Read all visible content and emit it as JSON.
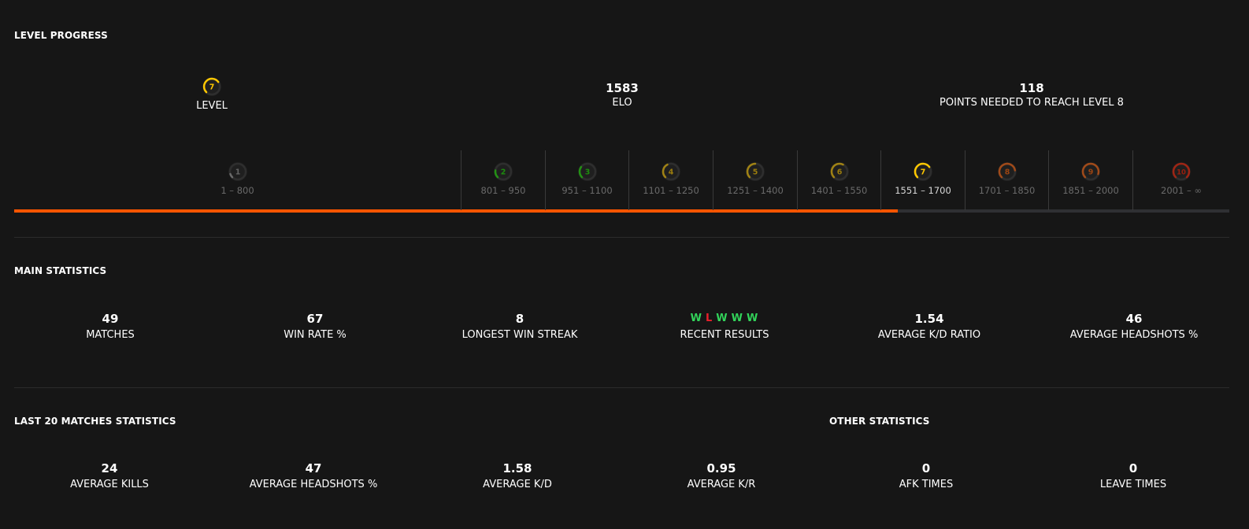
{
  "level_progress": {
    "title": "LEVEL PROGRESS",
    "level_label": "LEVEL",
    "level_value": "7",
    "elo_value": "1583",
    "elo_label": "ELO",
    "points_value": "118",
    "points_label": "POINTS NEEDED TO REACH LEVEL 8",
    "progress_fraction": 0.727,
    "levels": [
      {
        "num": "1",
        "range": "1 – 800",
        "color": "#9e9e9e",
        "fill": 0.1
      },
      {
        "num": "2",
        "range": "801 – 950",
        "color": "#1ce400",
        "fill": 0.2
      },
      {
        "num": "3",
        "range": "951 – 1100",
        "color": "#1ce400",
        "fill": 0.3
      },
      {
        "num": "4",
        "range": "1101 – 1250",
        "color": "#ffc800",
        "fill": 0.4
      },
      {
        "num": "5",
        "range": "1251 – 1400",
        "color": "#ffc800",
        "fill": 0.5
      },
      {
        "num": "6",
        "range": "1401 – 1550",
        "color": "#ffc800",
        "fill": 0.6
      },
      {
        "num": "7",
        "range": "1551 – 1700",
        "color": "#ffc800",
        "fill": 0.7
      },
      {
        "num": "8",
        "range": "1701 – 1850",
        "color": "#ff6309",
        "fill": 0.8
      },
      {
        "num": "9",
        "range": "1851 – 2000",
        "color": "#ff6309",
        "fill": 0.9
      },
      {
        "num": "10",
        "range": "2001 – ∞",
        "color": "#fe1f00",
        "fill": 1.0
      }
    ],
    "current_level_index": 6
  },
  "main_statistics": {
    "title": "MAIN STATISTICS",
    "matches": {
      "value": "49",
      "label": "MATCHES"
    },
    "win_rate": {
      "value": "67",
      "label": "WIN RATE %"
    },
    "longest_streak": {
      "value": "8",
      "label": "LONGEST WIN STREAK"
    },
    "recent_results": {
      "results": [
        "W",
        "L",
        "W",
        "W",
        "W"
      ],
      "label": "RECENT RESULTS"
    },
    "avg_kd": {
      "value": "1.54",
      "label": "AVERAGE K/D RATIO"
    },
    "avg_hs": {
      "value": "46",
      "label": "AVERAGE HEADSHOTS %"
    }
  },
  "last20": {
    "title": "LAST 20 MATCHES STATISTICS",
    "kills": {
      "value": "24",
      "label": "AVERAGE KILLS"
    },
    "hs": {
      "value": "47",
      "label": "AVERAGE HEADSHOTS %"
    },
    "kd": {
      "value": "1.58",
      "label": "AVERAGE K/D"
    },
    "kr": {
      "value": "0.95",
      "label": "AVERAGE K/R"
    }
  },
  "other": {
    "title": "OTHER STATISTICS",
    "afk": {
      "value": "0",
      "label": "AFK TIMES"
    },
    "leave": {
      "value": "0",
      "label": "LEAVE TIMES"
    }
  },
  "colors": {
    "accent": "#ff5500",
    "win": "#32d35a",
    "loss": "#e8202b"
  }
}
